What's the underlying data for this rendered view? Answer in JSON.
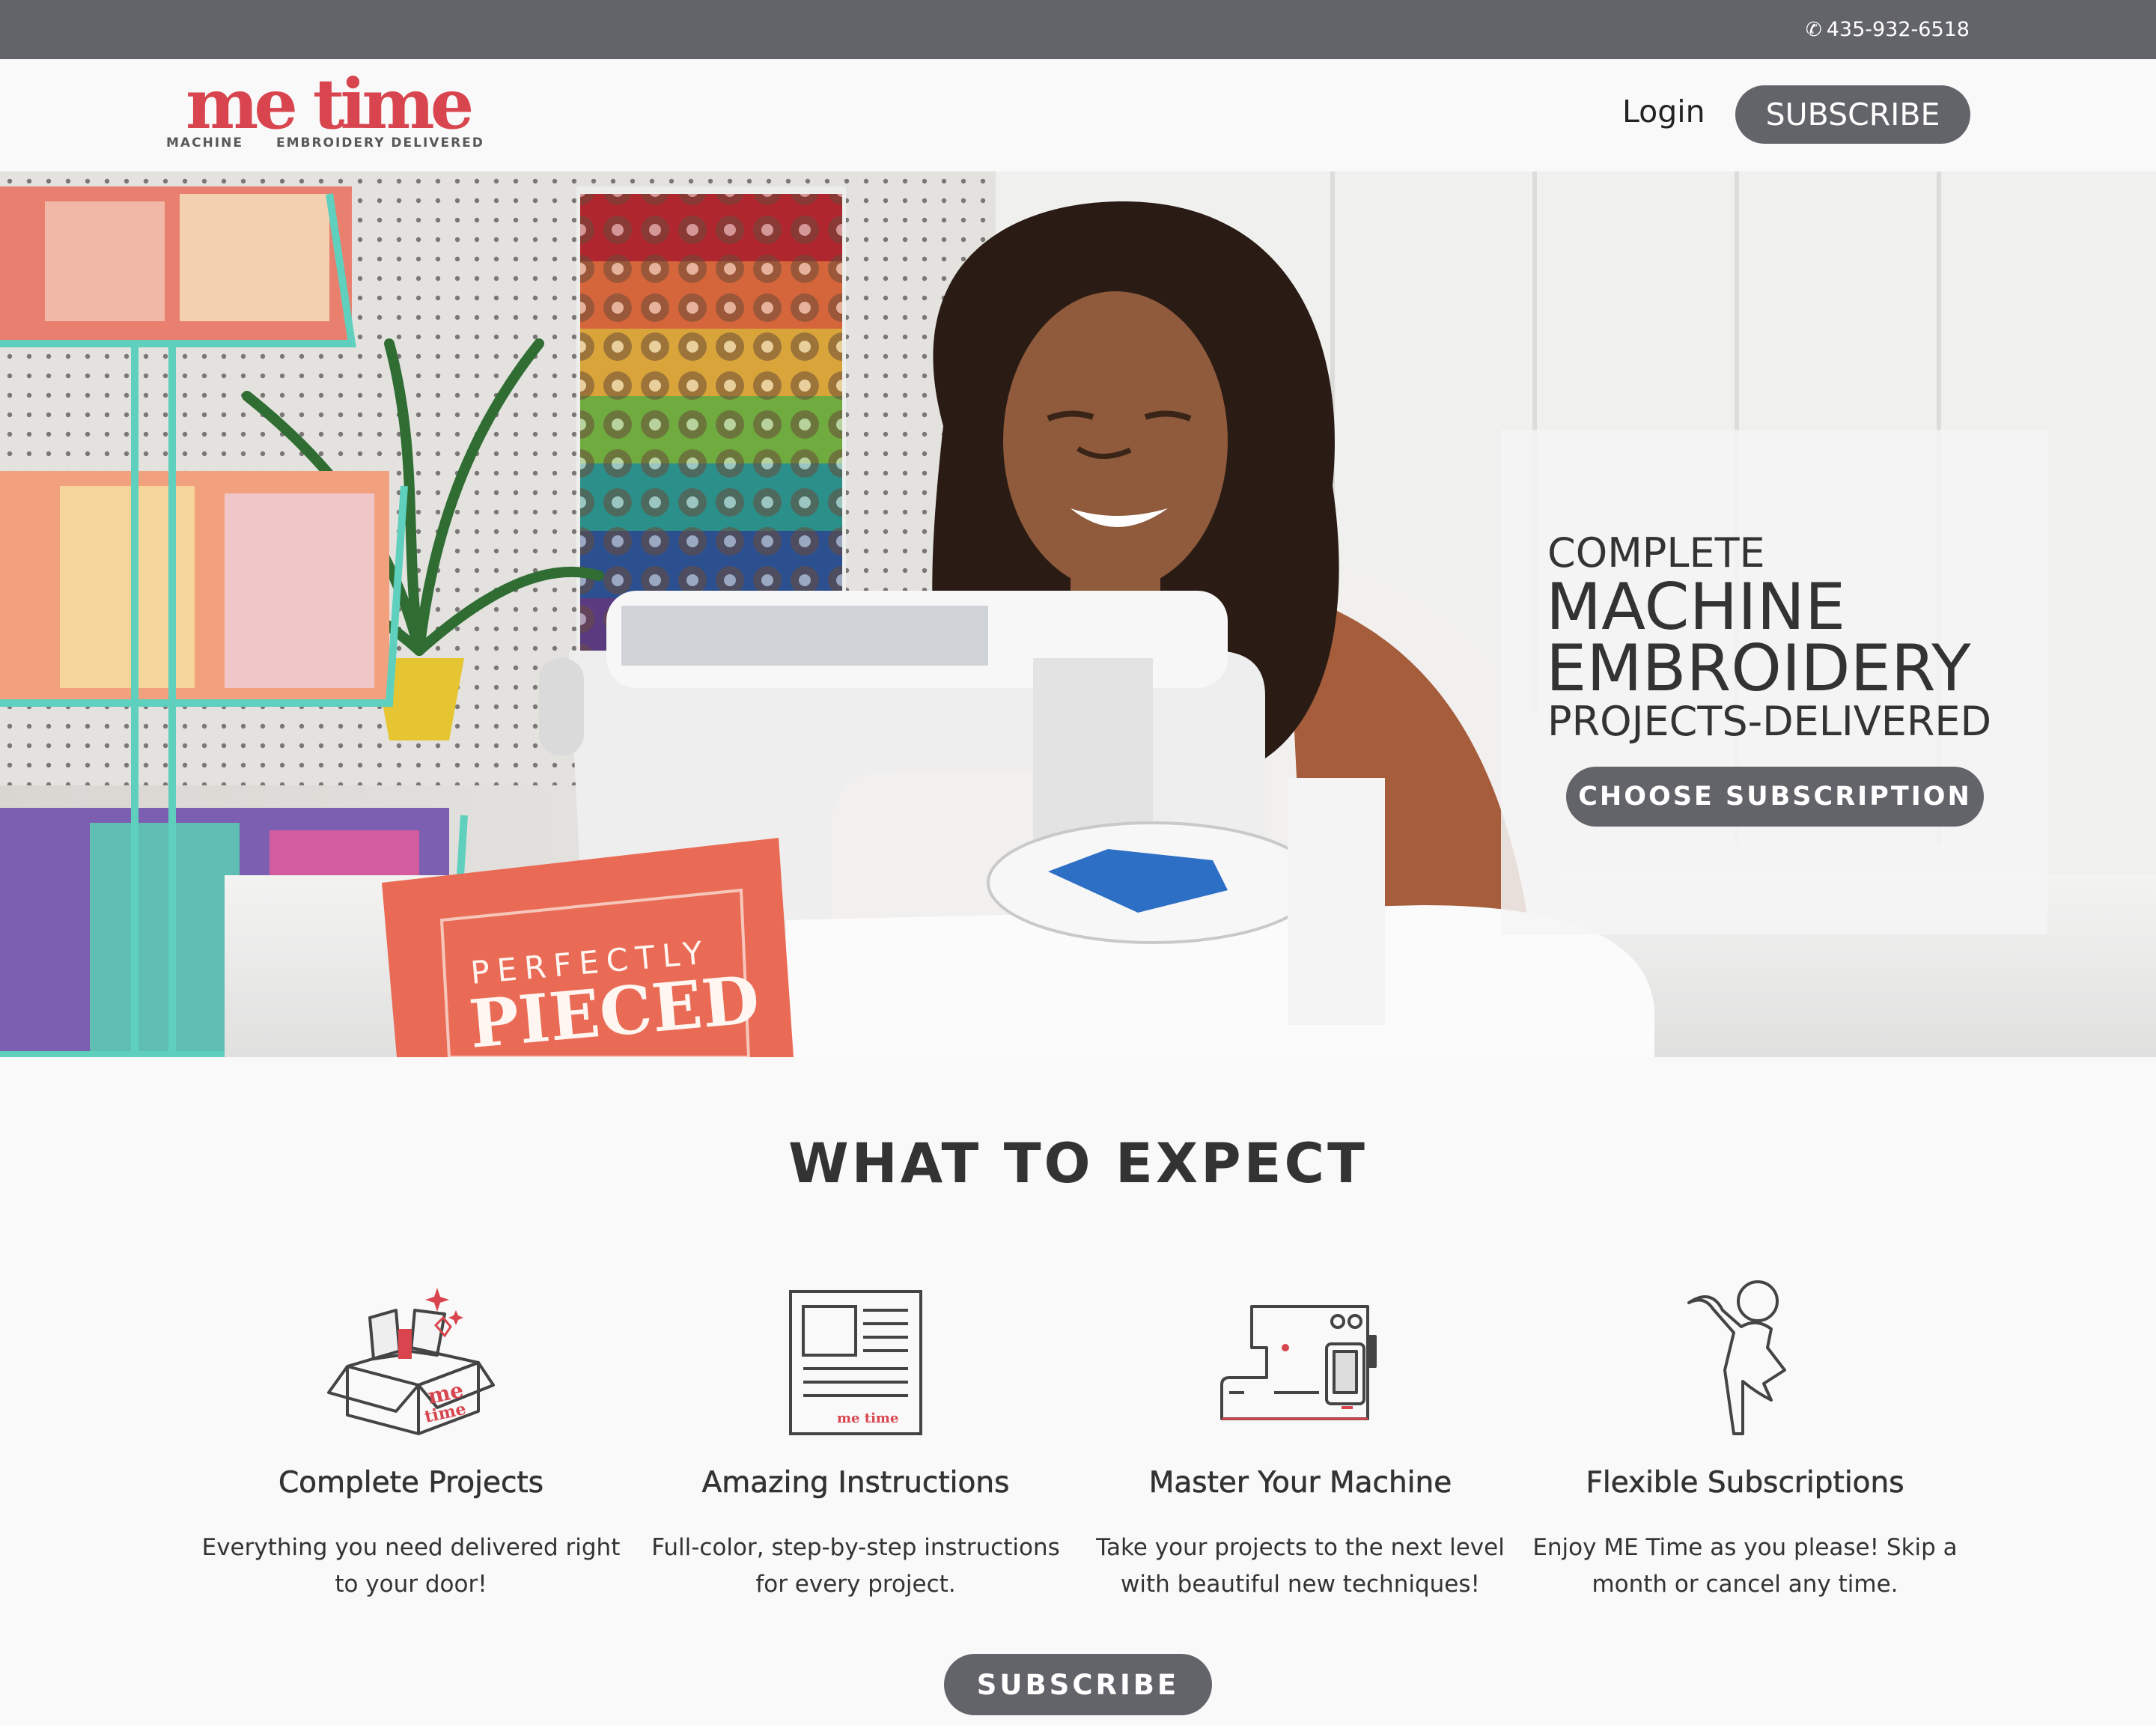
{
  "topbar": {
    "phone": "435-932-6518"
  },
  "header": {
    "logo_word": "me time",
    "logo_sub_left": "MACHINE",
    "logo_sub_right": "EMBROIDERY DELIVERED",
    "login_label": "Login",
    "subscribe_label": "SUBSCRIBE"
  },
  "hero": {
    "line1": "COMPLETE",
    "line2": "MACHINE",
    "line3": "EMBROIDERY",
    "line4": "PROJECTS-DELIVERED",
    "cta_label": "CHOOSE SUBSCRIPTION",
    "box_line1": "PERFECTLY",
    "box_line2": "PIECED"
  },
  "section": {
    "title": "WHAT TO EXPECT",
    "features": [
      {
        "title": "Complete Projects",
        "text": "Everything you need delivered right to your door!",
        "icon": "gift-box-icon"
      },
      {
        "title": "Amazing Instructions",
        "text": "Full-color, step-by-step instructions for every project.",
        "icon": "instructions-icon"
      },
      {
        "title": "Master Your Machine",
        "text": "Take your projects to the next level with beautiful new techniques!",
        "icon": "embroidery-machine-icon"
      },
      {
        "title": "Flexible Subscriptions",
        "text": "Enjoy ME Time as you please! Skip a month or cancel any time.",
        "icon": "dancing-person-icon"
      }
    ],
    "subscribe_label": "SUBSCRIBE"
  },
  "colors": {
    "accent": "#d8454e",
    "button": "#63646a",
    "topbar": "#63646a",
    "background": "#f9f9f9"
  }
}
